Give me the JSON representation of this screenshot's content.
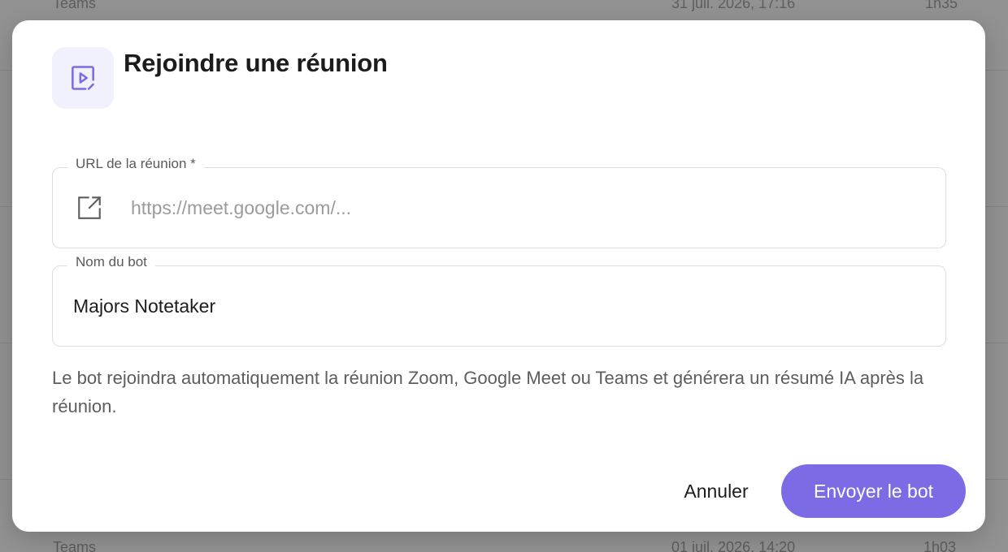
{
  "background": {
    "top_row": {
      "platform": "Teams",
      "date": "31 juil. 2026, 17:16",
      "duration": "1h35"
    },
    "bottom_row": {
      "platform": "Teams",
      "date": "01 juil. 2026, 14:20",
      "duration": "1h03"
    }
  },
  "modal": {
    "title": "Rejoindre une réunion",
    "title_icon": "video-play-icon",
    "url_field": {
      "label": "URL de la réunion *",
      "placeholder": "https://meet.google.com/...",
      "value": "",
      "icon": "external-link-icon"
    },
    "bot_field": {
      "label": "Nom du bot",
      "value": "Majors Notetaker"
    },
    "help_text": "Le bot rejoindra automatiquement la réunion Zoom, Google Meet ou Teams et générera un résumé IA après la réunion.",
    "cancel_label": "Annuler",
    "submit_label": "Envoyer le bot"
  },
  "colors": {
    "accent": "#7b6ce6",
    "icon_accent": "#7b6ce6",
    "icon_box_bg": "#f1f0fd",
    "overlay": "#929292"
  }
}
